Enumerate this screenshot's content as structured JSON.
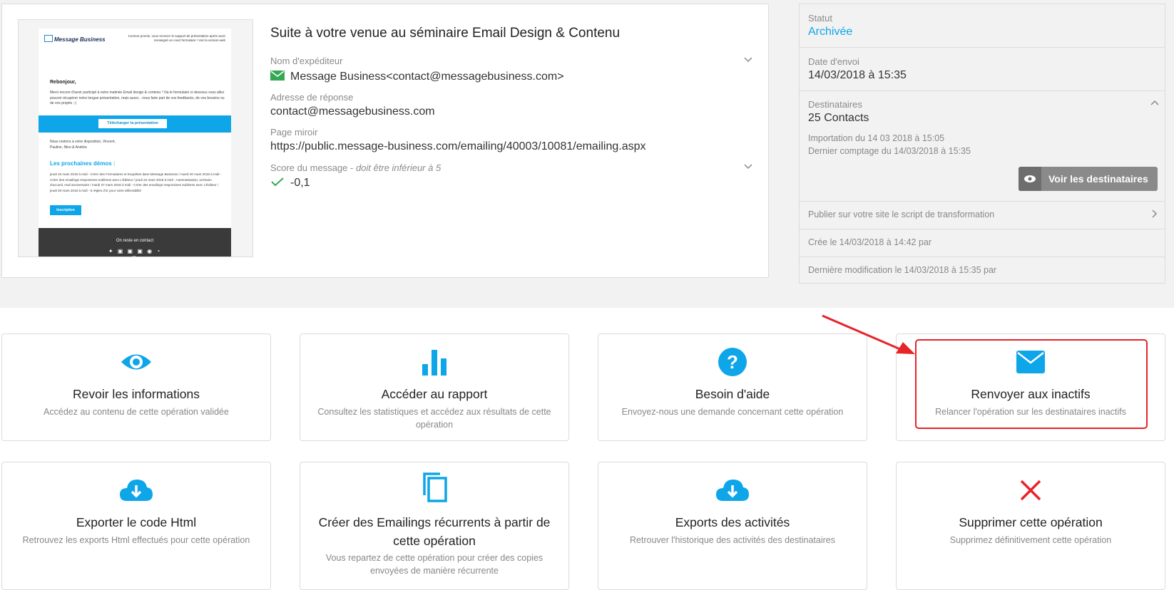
{
  "preview": {
    "logo": "Message Business",
    "note": "Comme promis, vous recevez le support de présentation après avoir renseigné un court formulaire ! Voir la version web",
    "greeting": "Rebonjour,",
    "intro": "Merci encore d'avoir participé à notre matinée Email design & contenu ! Via le formulaire ci-dessous vous allez pouvoir récupérer notre longue présentation, mais aussi... nous faire part de vos feedbacks, de vos besoins ou de vos projets ;-)",
    "download_label": "Télécharger la présentation",
    "closing": "Nous restons à votre disposition, Vincent, Pauline, Nino & Andréa",
    "demos_title": "Les prochaines démos :",
    "demos_list": "jeudi 15 mars 2018 à midi - Créer des Formulaires et Enquêtes dans Message Business / mardi 20 mars 2018 à midi - Créer des emailings responsives sublimes avec L'Éditeur / jeudi 22 mars 2018 à midi - Automatisation, scénario d'accueil, mail anniversaire / mardi 27 mars 2018 à midi - Créer des emailings responsives sublimes avec L'Éditeur / jeudi 29 mars 2018 à midi - 5 règles d'or pour votre délivrabilité",
    "signup_label": "Inscription",
    "footer_text": "On reste en contact"
  },
  "email": {
    "title": "Suite à votre venue au séminaire Email Design & Contenu",
    "sender_label": "Nom d'expéditeur",
    "sender_value": "Message Business<contact@messagebusiness.com>",
    "reply_label": "Adresse de réponse",
    "reply_value": "contact@messagebusiness.com",
    "mirror_label": "Page miroir",
    "mirror_value": "https://public.message-business.com/emailing/40003/10081/emailing.aspx",
    "score_label": "Score du message - ",
    "score_hint": "doit être inférieur à 5",
    "score_value": "-0,1"
  },
  "side": {
    "status_label": "Statut",
    "status_value": "Archivée",
    "send_label": "Date d'envoi",
    "send_value": "14/03/2018 à 15:35",
    "recipients_label": "Destinataires",
    "recipients_value": "25 Contacts",
    "import_text": "Importation du 14 03 2018 à 15:05",
    "count_text": "Dernier comptage du 14/03/2018 à 15:35",
    "view_button": "Voir les destinataires",
    "publish_text": "Publier sur votre site le script de transformation",
    "created_text": "Crée le 14/03/2018 à 14:42 par",
    "modified_text": "Dernière modification le 14/03/2018 à 15:35 par"
  },
  "actions": [
    {
      "title": "Revoir les informations",
      "desc": "Accédez au contenu de cette opération validée",
      "icon": "eye-icon"
    },
    {
      "title": "Accéder au rapport",
      "desc": "Consultez les statistiques et accédez aux résultats de cette opération",
      "icon": "bar-chart-icon"
    },
    {
      "title": "Besoin d'aide",
      "desc": "Envoyez-nous une demande concernant cette opération",
      "icon": "help-icon"
    },
    {
      "title": "Renvoyer aux inactifs",
      "desc": "Relancer l'opération sur les destinataires inactifs",
      "icon": "envelope-icon"
    },
    {
      "title": "Exporter le code Html",
      "desc": "Retrouvez les exports Html effectués pour cette opération",
      "icon": "cloud-download-icon"
    },
    {
      "title": "Créer des Emailings récurrents à partir de cette opération",
      "desc": "Vous repartez de cette opération pour créer des copies envoyées de manière récurrente",
      "icon": "copy-icon"
    },
    {
      "title": "Exports des activités",
      "desc": "Retrouver l'historique des activités des destinataires",
      "icon": "cloud-download-icon"
    },
    {
      "title": "Supprimer cette opération",
      "desc": "Supprimez définitivement cette opération",
      "icon": "close-icon"
    }
  ],
  "colors": {
    "accent": "#0ea5e9",
    "danger": "#e8232a",
    "success": "#34a853",
    "annotation": "#e8232a"
  }
}
